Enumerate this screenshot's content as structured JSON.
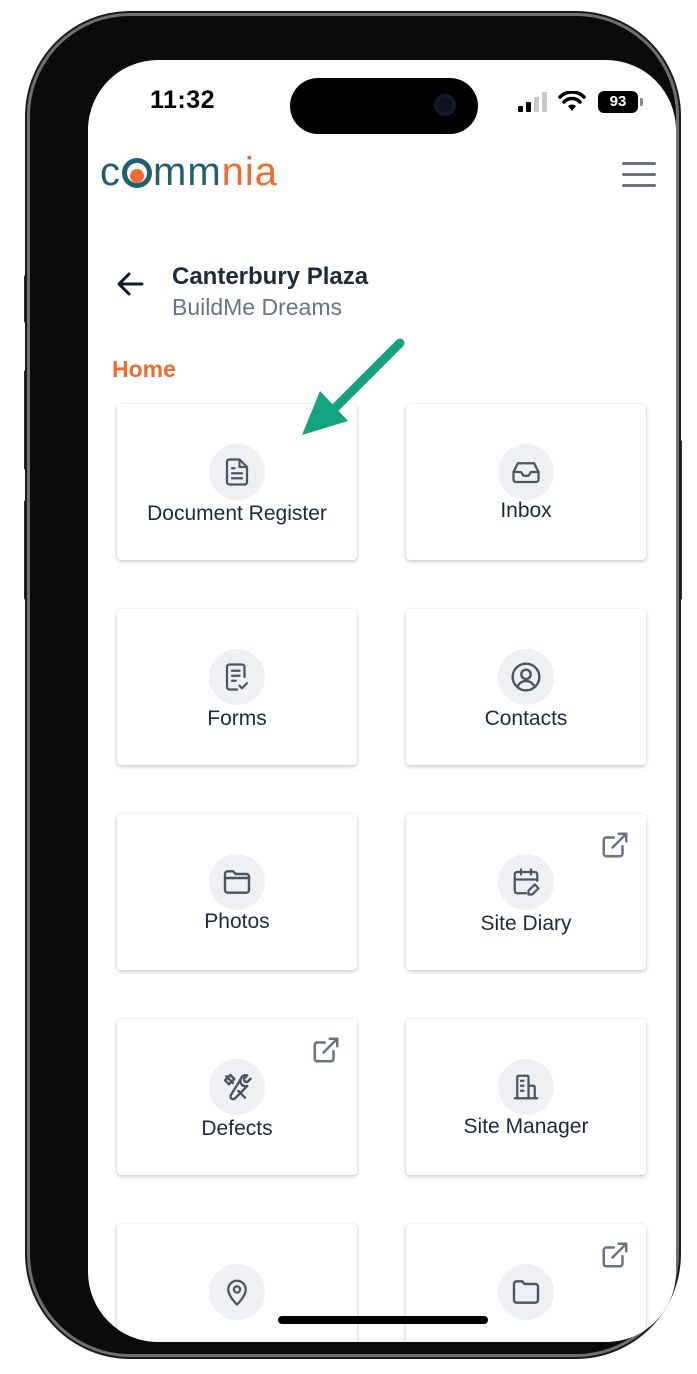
{
  "status_bar": {
    "time": "11:32",
    "battery": "93"
  },
  "header": {
    "logo_prefix": "c",
    "logo_mid": "mm",
    "logo_suffix": "nia"
  },
  "project": {
    "title": "Canterbury Plaza",
    "subtitle": "BuildMe Dreams"
  },
  "section": {
    "title": "Home"
  },
  "tiles": [
    {
      "label": "Document Register",
      "icon": "document-icon",
      "external": false
    },
    {
      "label": "Inbox",
      "icon": "inbox-icon",
      "external": false
    },
    {
      "label": "Forms",
      "icon": "form-check-icon",
      "external": false
    },
    {
      "label": "Contacts",
      "icon": "user-circle-icon",
      "external": false
    },
    {
      "label": "Photos",
      "icon": "folder-icon",
      "external": false
    },
    {
      "label": "Site Diary",
      "icon": "calendar-edit-icon",
      "external": true
    },
    {
      "label": "Defects",
      "icon": "tools-icon",
      "external": true
    },
    {
      "label": "Site Manager",
      "icon": "building-icon",
      "external": false
    },
    {
      "label": "",
      "icon": "location-pin-icon",
      "external": false
    },
    {
      "label": "",
      "icon": "folder-icon",
      "external": true
    }
  ],
  "colors": {
    "brand": "#1f5f73",
    "accent": "#f26a2e",
    "annotation_arrow": "#14a37f"
  }
}
